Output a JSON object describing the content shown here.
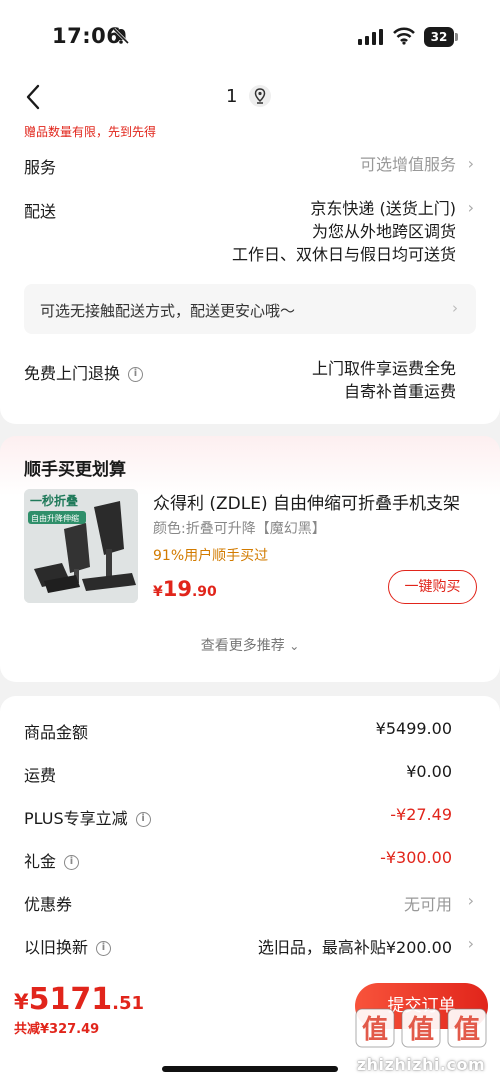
{
  "status": {
    "time": "17:06",
    "battery": "32"
  },
  "header": {
    "qty": "1"
  },
  "gift_note": "赠品数量有限，先到先得",
  "service": {
    "label": "服务",
    "value": "可选增值服务"
  },
  "delivery": {
    "label": "配送",
    "lines": [
      "京东快递 (送货上门)",
      "为您从外地跨区调货",
      "工作日、双休日与假日均可送货"
    ]
  },
  "contactless": {
    "text": "可选无接触配送方式，配送更安心哦～"
  },
  "return": {
    "label": "免费上门退换",
    "lines": [
      "上门取件享运费全免",
      "自寄补首重运费"
    ]
  },
  "recommend": {
    "title": "顺手买更划算",
    "image_text": {
      "top": "一秒折叠",
      "tag": "自由升降伸缩"
    },
    "product_name": "众得利 (ZDLE) 自由伸缩可折叠手机支架",
    "color": "颜色:折叠可升降【魔幻黑】",
    "stat": "91%用户顺手买过",
    "price": {
      "currency": "¥",
      "int": "19",
      "dec": ".90"
    },
    "buy_label": "一键购买",
    "more_label": "查看更多推荐"
  },
  "summary": {
    "rows": [
      {
        "label": "商品金额",
        "value": "¥5499.00",
        "style": "normal"
      },
      {
        "label": "运费",
        "value": "¥0.00",
        "style": "normal"
      },
      {
        "label": "PLUS专享立减",
        "value": "-¥27.49",
        "style": "red"
      },
      {
        "label": "礼金",
        "value": "-¥300.00",
        "style": "red"
      },
      {
        "label": "优惠券",
        "value": "无可用",
        "style": "muted"
      },
      {
        "label": "以旧换新",
        "value": "选旧品，最高补贴¥200.00",
        "style": "normal"
      }
    ]
  },
  "total": {
    "currency": "¥",
    "int": "5171",
    "dec": ".51",
    "saved": "共减¥327.49",
    "submit": "提交订单"
  },
  "watermark": {
    "brand": "值",
    "url": "zhizhizhi.com"
  },
  "colors": {
    "accent": "#e1251b",
    "stat": "#d27b00"
  }
}
